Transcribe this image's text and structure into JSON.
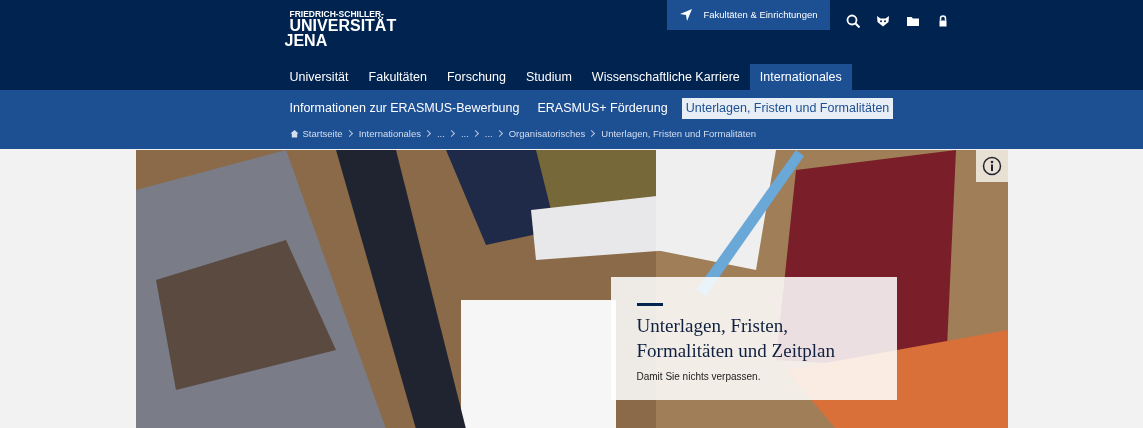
{
  "logo": {
    "lines": [
      "FRIEDRICH-SCHILLER-",
      "UNIVERSITÄT",
      "JENA"
    ]
  },
  "top_links": [
    {
      "label": "Fakultäten & Einrichtungen"
    }
  ],
  "main_nav": [
    {
      "label": "Universität",
      "selected": false
    },
    {
      "label": "Fakultäten",
      "selected": false
    },
    {
      "label": "Forschung",
      "selected": false
    },
    {
      "label": "Studium",
      "selected": false
    },
    {
      "label": "Wissenschaftliche Karriere",
      "selected": false
    },
    {
      "label": "Internationales",
      "selected": true
    }
  ],
  "sub_nav": [
    {
      "label": "Informationen zur ERASMUS-Bewerbung",
      "selected": false
    },
    {
      "label": "ERASMUS+ Förderung",
      "selected": false
    },
    {
      "label": "Unterlagen, Fristen und Formalitäten",
      "selected": true
    }
  ],
  "breadcrumb": [
    "Startseite",
    "Internationales",
    "...",
    "...",
    "...",
    "Organisatorisches",
    "Unterlagen, Fristen und Formalitäten"
  ],
  "hero": {
    "kind": "picture",
    "caption": {
      "title": "Unterlagen, Fristen, Formalitäten und Zeitplan",
      "subtitle": "Damit Sie nichts verpassen."
    }
  }
}
